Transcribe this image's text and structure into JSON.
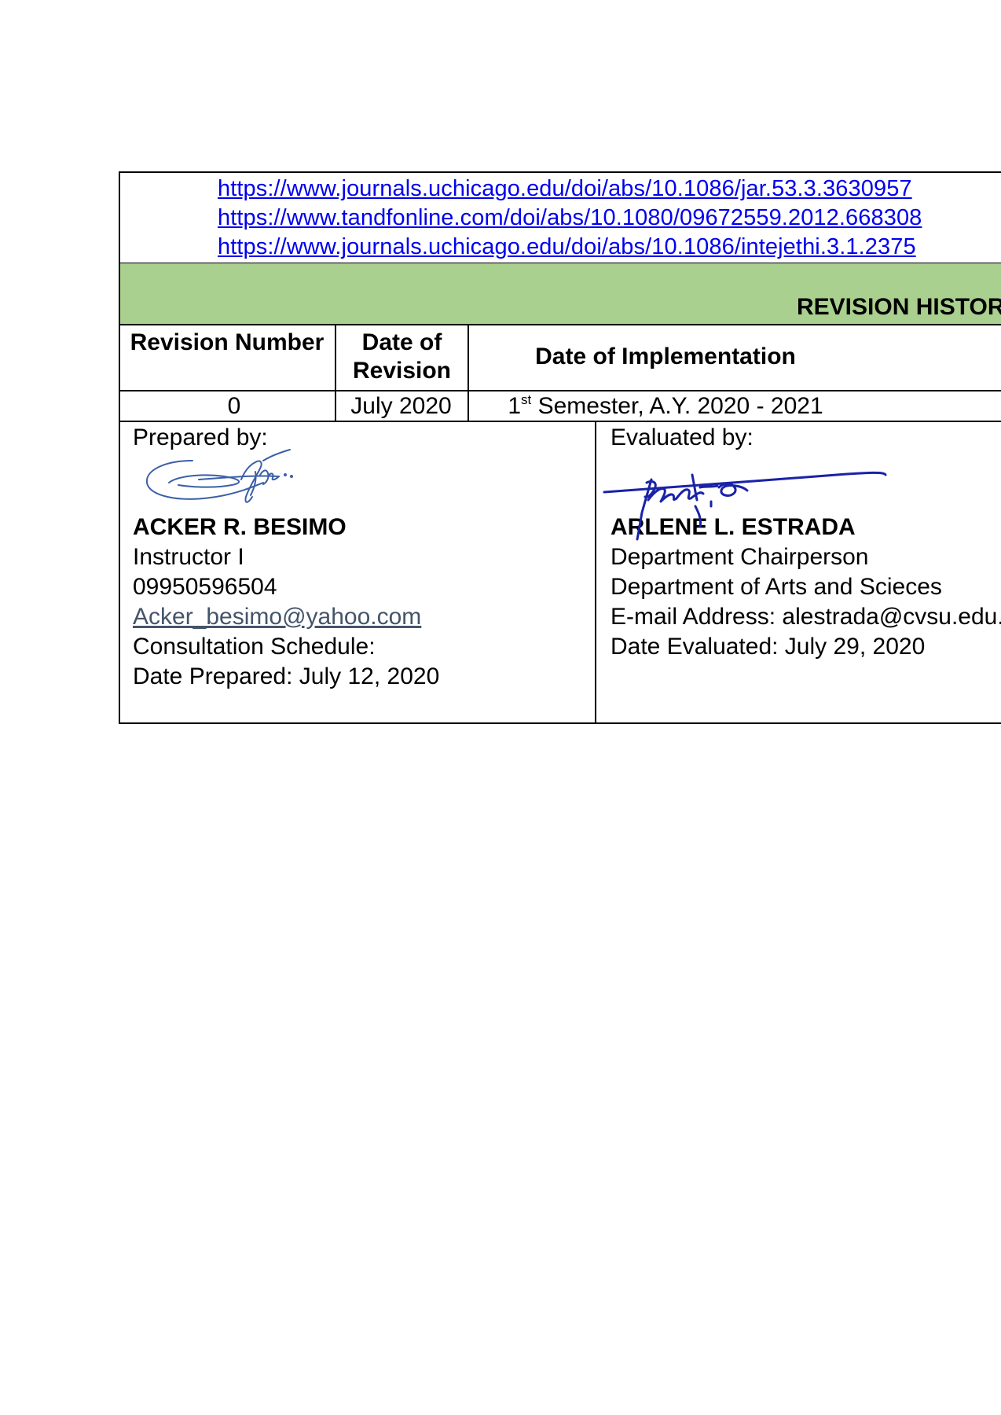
{
  "references": {
    "links": [
      "https://www.journals.uchicago.edu/doi/abs/10.1086/jar.53.3.3630957",
      "https://www.tandfonline.com/doi/abs/10.1080/09672559.2012.668308",
      "https://www.journals.uchicago.edu/doi/abs/10.1086/intejethi.3.1.2375"
    ]
  },
  "revision_history": {
    "title": "REVISION HISTORY",
    "headers": {
      "revision_number": "Revision Number",
      "date_of_revision": "Date of Revision",
      "date_of_implementation": "Date of Implementation"
    },
    "rows": [
      {
        "revision_number": "0",
        "date_of_revision": "July 2020",
        "implementation_ordinal": "1",
        "implementation_suffix": "st",
        "implementation_rest": " Semester, A.Y. 2020 - 2021"
      }
    ]
  },
  "prepared": {
    "label": "Prepared by:",
    "name": "ACKER R. BESIMO",
    "position": "Instructor I",
    "phone": "09950596504",
    "email": "Acker_besimo@yahoo.com",
    "schedule": "Consultation Schedule:",
    "date": "Date Prepared: July 12, 2020",
    "signature_color": "#3a5fa8"
  },
  "evaluated": {
    "label": "Evaluated by:",
    "name": "ARLENE L. ESTRADA",
    "position": "Department Chairperson",
    "department": "Department of Arts and Scieces",
    "email_line": "E-mail Address: alestrada@cvsu.edu.ph",
    "date": "Date Evaluated: July 29, 2020",
    "signature_color": "#1a22a8"
  }
}
